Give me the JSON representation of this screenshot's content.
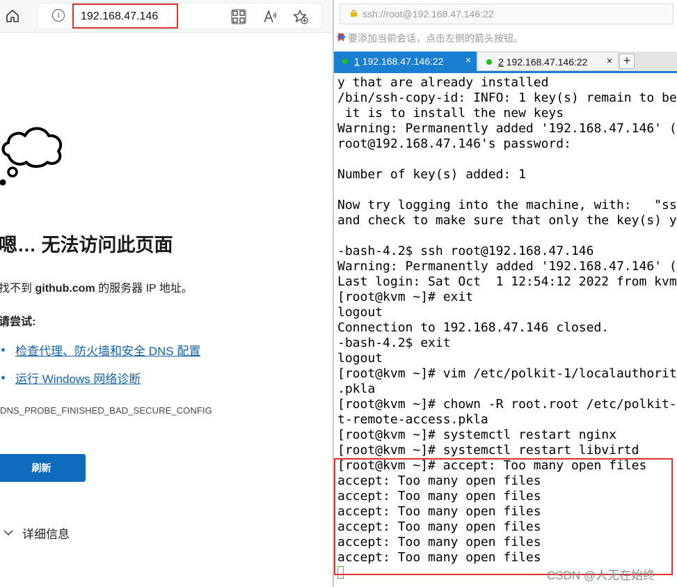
{
  "browser": {
    "address": "192.168.47.146",
    "icons": [
      "home-icon",
      "info-icon",
      "app-grid-icon",
      "read-aloud-icon",
      "add-favorite-icon"
    ],
    "error": {
      "title": "嗯… 无法访问此页面",
      "desc_prefix": "找不到",
      "desc_domain": "github.com",
      "desc_suffix": "的服务器 IP 地址。",
      "try_label": "请尝试:",
      "suggestions": [
        "检查代理、防火墙和安全 DNS 配置",
        "运行 Windows 网络诊断"
      ],
      "code": "DNS_PROBE_FINISHED_BAD_SECURE_CONFIG",
      "refresh_label": "刷新",
      "details_label": "详细信息"
    }
  },
  "terminal": {
    "connection_url": "ssh://root@192.168.47.146:22",
    "hint": "要添加当前会话，点击左侧的箭头按钮。",
    "tabs": [
      {
        "num": "1",
        "title": " 192.168.47.146:22",
        "active": true
      },
      {
        "num": "2",
        "title": " 192.168.47.146:22",
        "active": false
      }
    ],
    "tab_close": "×",
    "tab_add": "+",
    "output": "y that are already installed\n/bin/ssh-copy-id: INFO: 1 key(s) remain to be\n it is to install the new keys\nWarning: Permanently added '192.168.47.146' (\nroot@192.168.47.146's password:\n\nNumber of key(s) added: 1\n\nNow try logging into the machine, with:   \"ss\nand check to make sure that only the key(s) y\n\n-bash-4.2$ ssh root@192.168.47.146\nWarning: Permanently added '192.168.47.146' (\nLast login: Sat Oct  1 12:54:12 2022 from kvm\n[root@kvm ~]# exit\nlogout\nConnection to 192.168.47.146 closed.\n-bash-4.2$ exit\nlogout\n[root@kvm ~]# vim /etc/polkit-1/localauthorit\n.pkla\n[root@kvm ~]# chown -R root.root /etc/polkit-\nt-remote-access.pkla\n[root@kvm ~]# systemctl restart nginx\n[root@kvm ~]# systemctl restart libvirtd\n[root@kvm ~]# accept: Too many open files\naccept: Too many open files\naccept: Too many open files\naccept: Too many open files\naccept: Too many open files\naccept: Too many open files\naccept: Too many open files",
    "colors": {
      "tab_active": "#1a7ed1",
      "status_dot": "#1fc11f",
      "highlight": "#e03030"
    }
  },
  "watermark": "CSDN @人无在始终"
}
